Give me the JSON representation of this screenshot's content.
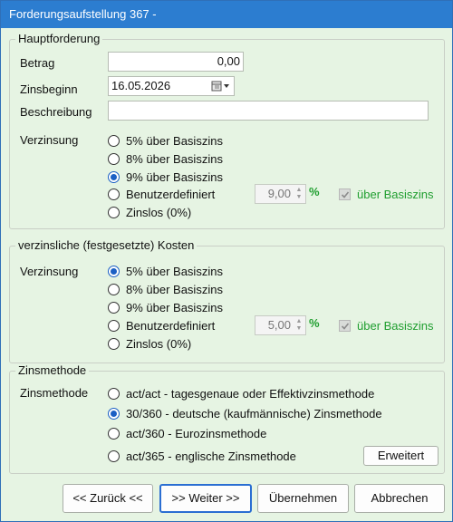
{
  "window": {
    "title": "Forderungsaufstellung 367 -"
  },
  "haupt": {
    "legend": "Hauptforderung",
    "betrag_label": "Betrag",
    "betrag_value": "0,00",
    "zinsbeginn_label": "Zinsbeginn",
    "zinsbeginn_value": "16.05.2026",
    "beschreibung_label": "Beschreibung",
    "beschreibung_value": "",
    "verzinsung_label": "Verzinsung",
    "options": [
      "5% über Basiszins",
      "8% über Basiszins",
      "9% über Basiszins",
      "Benutzerdefiniert",
      "Zinslos (0%)"
    ],
    "selected": "9% über Basiszins",
    "custom_rate": "9,00",
    "pct_symbol": "%",
    "ueber_basiszins_label": "über Basiszins",
    "ueber_basiszins_checked": true
  },
  "kosten": {
    "legend": "verzinsliche (festgesetzte) Kosten",
    "verzinsung_label": "Verzinsung",
    "options": [
      "5% über Basiszins",
      "8% über Basiszins",
      "9% über Basiszins",
      "Benutzerdefiniert",
      "Zinslos (0%)"
    ],
    "selected": "5% über Basiszins",
    "custom_rate": "5,00",
    "pct_symbol": "%",
    "ueber_basiszins_label": "über Basiszins",
    "ueber_basiszins_checked": true
  },
  "zinsmethode": {
    "legend": "Zinsmethode",
    "label": "Zinsmethode",
    "options": [
      "act/act - tagesgenaue oder Effektivzinsmethode",
      "30/360 - deutsche (kaufmännische) Zinsmethode",
      "act/360 - Eurozinsmethode",
      "act/365 - englische Zinsmethode"
    ],
    "selected": "30/360 - deutsche (kaufmännische) Zinsmethode",
    "erweitert_label": "Erweitert"
  },
  "buttons": {
    "zurueck": "<< Zurück <<",
    "weiter": ">> Weiter >>",
    "uebernehmen": "Übernehmen",
    "abbrechen": "Abbrechen"
  },
  "colors": {
    "titlebar": "#2c7dd0",
    "background": "#e6f4e3",
    "accent_green": "#1f9e2f",
    "radio_selected": "#1b5fc4"
  }
}
